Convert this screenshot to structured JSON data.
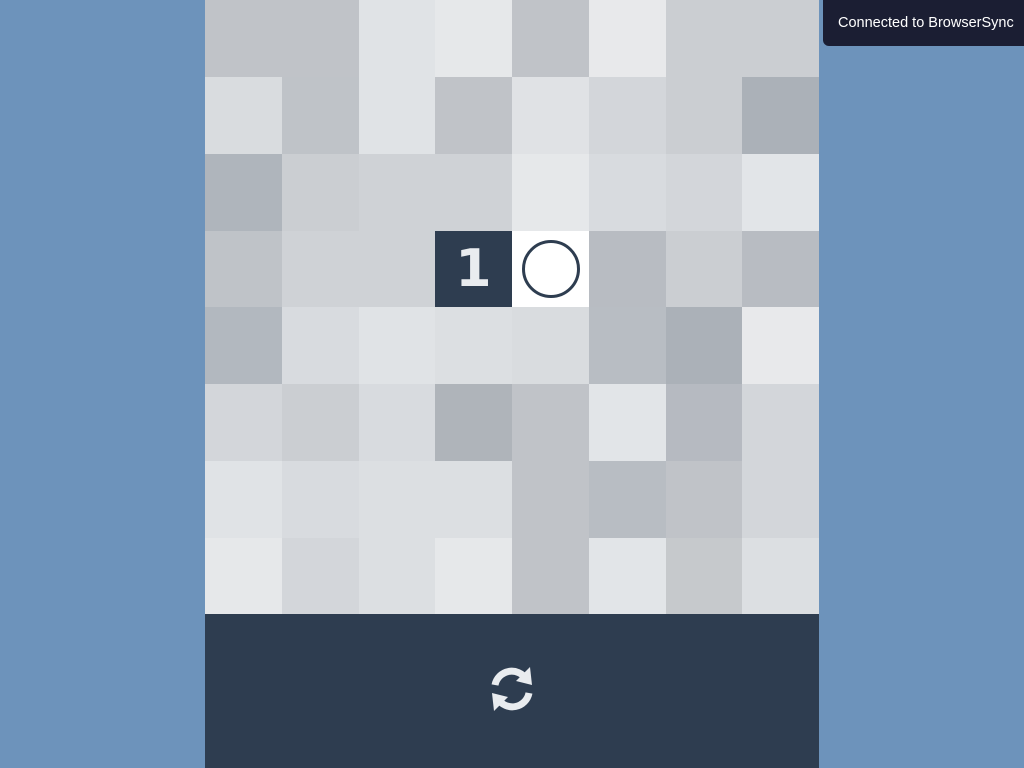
{
  "theme": {
    "background": "#6d93bb",
    "dark": "#2e3d50",
    "notify_bg": "#1b1e33"
  },
  "board": {
    "cells": [
      [
        "#c0c3c8",
        "#c0c3c8",
        "#e0e3e6",
        "#e6e8ea",
        "#c0c3c8",
        "#e8e9eb",
        "#cbced2",
        "#cbced2"
      ],
      [
        "#d9dcdf",
        "#bfc3c8",
        "#e0e3e6",
        "#c0c3c8",
        "#e0e2e5",
        "#d3d6da",
        "#cbced2",
        "#abb1b8"
      ],
      [
        "#afb5bc",
        "#cbced2",
        "#cfd2d6",
        "#cfd2d6",
        "#e6e8ea",
        "#d8dbdf",
        "#d3d6da",
        "#e2e5e8"
      ],
      [
        "#bfc3c8",
        "#cfd2d6",
        "#cfd2d6",
        {
          "kind": "number",
          "value": "1"
        },
        {
          "kind": "ring"
        },
        "#b8bcc2",
        "#cbced2",
        "#b8bcc2"
      ],
      [
        "#b2b8bf",
        "#d8dbdf",
        "#e0e3e6",
        "#dcdfe2",
        "#d9dcdf",
        "#b8bdc3",
        "#abb1b8",
        "#e8e9eb"
      ],
      [
        "#d3d6da",
        "#cbced2",
        "#d8dbdf",
        "#afb4ba",
        "#c0c3c8",
        "#e2e5e8",
        "#b6bac1",
        "#d3d6da"
      ],
      [
        "#e0e3e6",
        "#d8dbdf",
        "#dcdfe2",
        "#dcdfe2",
        "#c0c3c8",
        "#b8bdc3",
        "#c0c3c8",
        "#d3d6da"
      ],
      [
        "#e6e8ea",
        "#d3d6da",
        "#dcdfe2",
        "#e6e8ea",
        "#c0c3c8",
        "#e2e5e8",
        "#c6c9cc",
        "#dcdfe2"
      ]
    ]
  },
  "footer": {
    "reset_icon": "refresh-icon"
  },
  "notification": {
    "text": "Connected to BrowserSync"
  }
}
